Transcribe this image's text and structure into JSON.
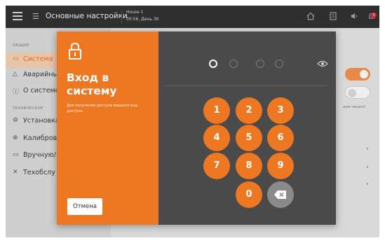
{
  "topbar": {
    "title": "Основные настройки",
    "house": "House 1",
    "time": "00:56, День 30",
    "notification_count": "3"
  },
  "sidebar": {
    "section_general": "ОБЩИЙ",
    "section_technical": "ТЕХНИЧЕСКОЕ",
    "items": [
      {
        "label": "Система",
        "icon": "monitor-icon",
        "active": true
      },
      {
        "label": "Аварийны",
        "icon": "alarm-icon"
      },
      {
        "label": "О системе",
        "icon": "info-icon"
      },
      {
        "label": "Установка",
        "icon": "install-icon"
      },
      {
        "label": "Калибров",
        "icon": "calibration-icon"
      },
      {
        "label": "Вручную/",
        "icon": "manual-icon"
      },
      {
        "label": "Техобслу",
        "icon": "maintenance-icon"
      }
    ]
  },
  "background_hint": "дом чищеся",
  "login": {
    "title": "Вход в систему",
    "description": "Для получения доступа введите код доступа.",
    "cancel_label": "Отмена",
    "pin_length": 4,
    "keys": [
      "1",
      "2",
      "3",
      "4",
      "5",
      "6",
      "7",
      "8",
      "9",
      "0"
    ]
  },
  "colors": {
    "accent": "#ee7722",
    "panel_dark": "#4a4a4a",
    "topbar": "#2f2f2f",
    "badge": "#e3232b"
  }
}
